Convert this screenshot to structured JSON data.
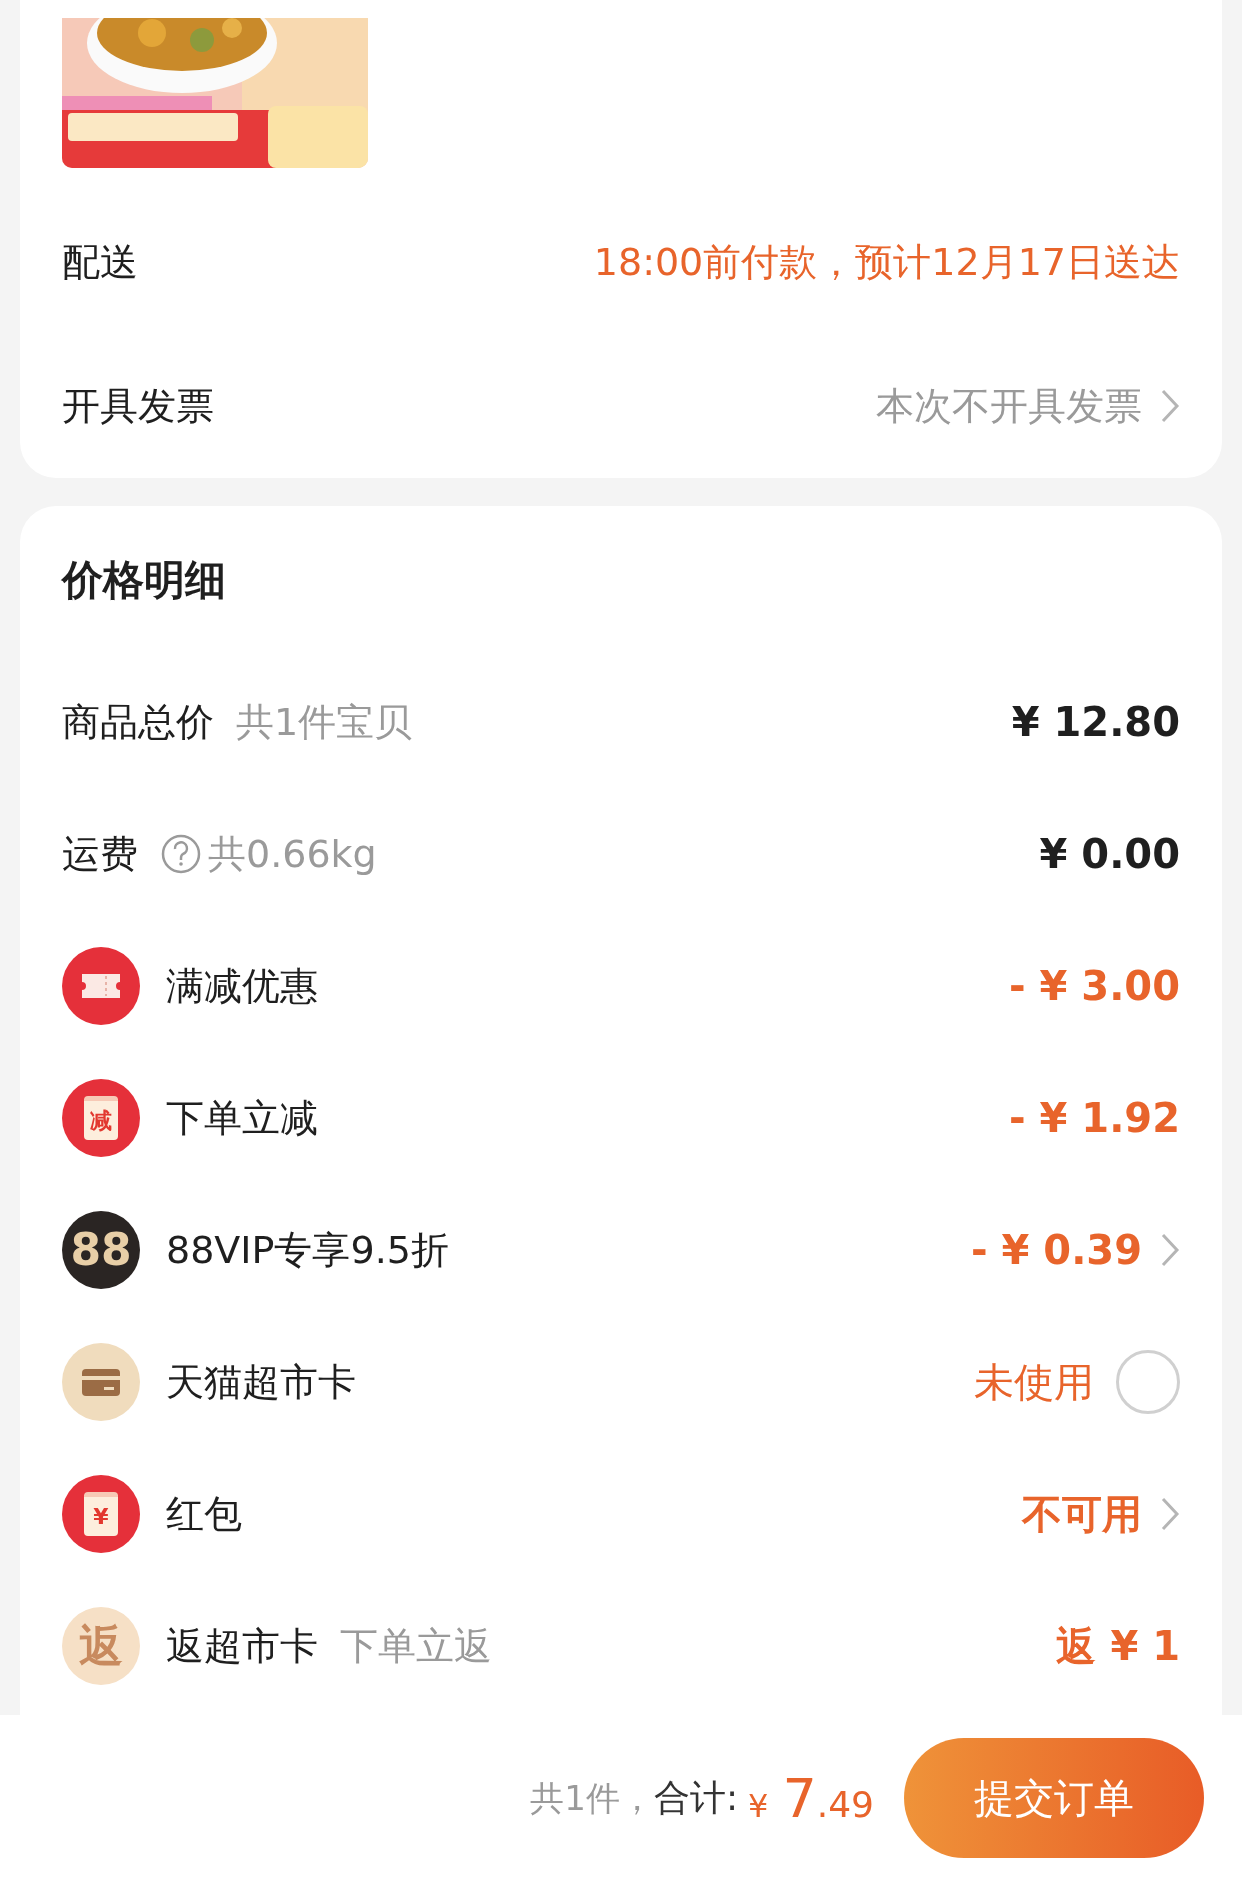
{
  "order_card": {
    "delivery": {
      "label": "配送",
      "value": "18:00前付款，预计12月17日送达"
    },
    "invoice": {
      "label": "开具发票",
      "value": "本次不开具发票"
    }
  },
  "price_detail": {
    "title": "价格明细",
    "rows": [
      {
        "kind": "plain",
        "label": "商品总价",
        "note": "共1件宝贝",
        "amount": "¥ 12.80",
        "highlight": false
      },
      {
        "kind": "plain",
        "label": "运费",
        "note": "共0.66kg",
        "help": true,
        "amount": "¥ 0.00",
        "highlight": false
      },
      {
        "kind": "plain",
        "label": "满减优惠",
        "amount": "- ¥ 3.00",
        "highlight": true
      },
      {
        "kind": "plain",
        "icon_text": "减",
        "label": "下单立减",
        "amount": "- ¥ 1.92",
        "highlight": true
      },
      {
        "kind": "link",
        "icon_text": "88",
        "label": "88VIP专享9.5折",
        "amount": "- ¥ 0.39",
        "highlight": true
      },
      {
        "kind": "radio",
        "label": "天猫超市卡",
        "amount": "未使用",
        "highlight": true,
        "checked": false
      },
      {
        "kind": "link",
        "icon_text": "¥",
        "label": "红包",
        "amount": "不可用",
        "highlight": true
      },
      {
        "kind": "plain",
        "icon_text": "返",
        "label": "返超市卡",
        "note": "下单立返",
        "amount": "返 ¥ 1",
        "highlight": true
      }
    ]
  },
  "footer": {
    "count": "共1件，",
    "total_label": "合计:",
    "currency": "¥",
    "total_int": "7",
    "total_dec": ".49",
    "submit": "提交订单"
  }
}
